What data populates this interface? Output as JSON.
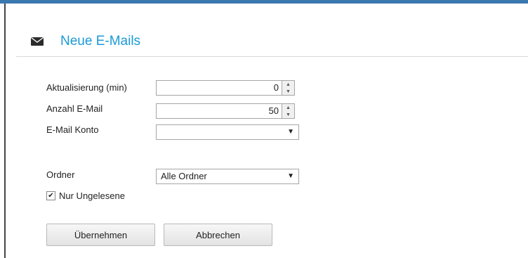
{
  "panel": {
    "title": "Neue E-Mails",
    "icon": "envelope-icon",
    "accent_color": "#1a9ad6"
  },
  "form": {
    "refresh": {
      "label": "Aktualisierung (min)",
      "value": "0"
    },
    "mail_count": {
      "label": "Anzahl E-Mail",
      "value": "50"
    },
    "account": {
      "label": "E-Mail Konto",
      "value": ""
    },
    "folder": {
      "label": "Ordner",
      "value": "Alle Ordner"
    },
    "unread_only": {
      "label": "Nur Ungelesene",
      "checked": true
    }
  },
  "buttons": {
    "apply": "Übernehmen",
    "cancel": "Abbrechen"
  }
}
